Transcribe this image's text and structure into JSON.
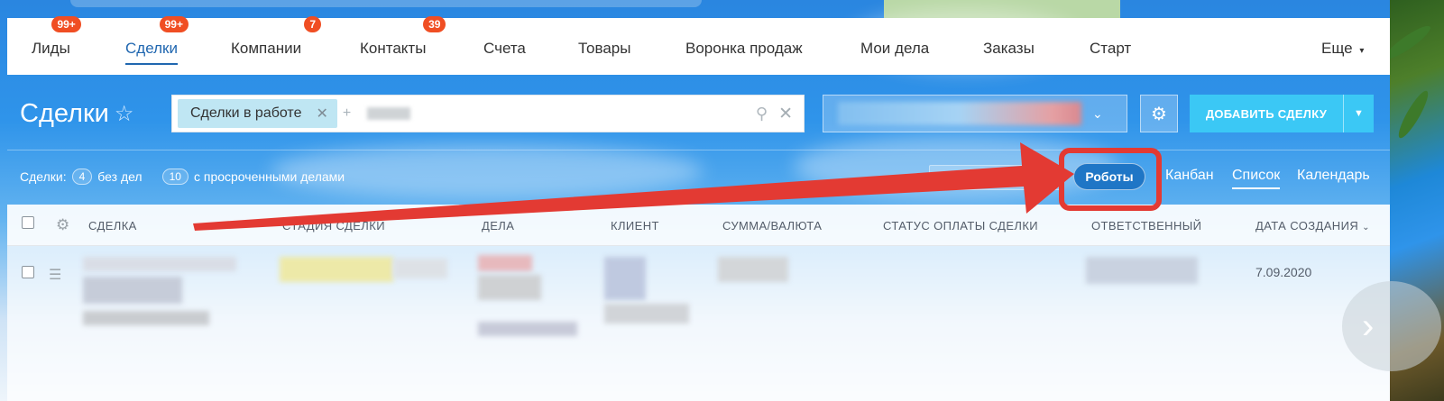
{
  "nav": {
    "items": [
      {
        "label": "Лиды",
        "badge": "99+"
      },
      {
        "label": "Сделки",
        "badge": "99+",
        "active": true
      },
      {
        "label": "Компании",
        "badge": "7"
      },
      {
        "label": "Контакты",
        "badge": "39"
      },
      {
        "label": "Счета"
      },
      {
        "label": "Товары"
      },
      {
        "label": "Воронка продаж"
      },
      {
        "label": "Мои дела"
      },
      {
        "label": "Заказы"
      },
      {
        "label": "Старт"
      }
    ],
    "more_label": "Еще",
    "more_icon": "chevron-down-icon"
  },
  "header": {
    "title": "Сделки",
    "favorite_icon": "star-icon"
  },
  "filter": {
    "chip_label": "Сделки в работе",
    "chip_close_icon": "close-icon",
    "add_icon": "plus-icon",
    "search_icon": "search-icon",
    "clear_icon": "close-icon"
  },
  "toolbar": {
    "settings_icon": "gear-icon",
    "add_button_label": "ДОБАВИТЬ СДЕЛКУ",
    "add_button_arrow_icon": "caret-down-icon"
  },
  "stats": {
    "deals_label": "Сделки:",
    "without_tasks_count": "4",
    "without_tasks_label": "без дел",
    "overdue_count": "10",
    "overdue_label": "с просроченными делами"
  },
  "views": {
    "robots_label": "Роботы",
    "kanban_label": "Канбан",
    "list_label": "Список",
    "calendar_label": "Календарь",
    "active": "Список"
  },
  "table": {
    "columns": [
      "СДЕЛКА",
      "СТАДИЯ СДЕЛКИ",
      "ДЕЛА",
      "КЛИЕНТ",
      "СУММА/ВАЛЮТА",
      "СТАТУС ОПЛАТЫ СДЕЛКИ",
      "ОТВЕТСТВЕННЫЙ",
      "ДАТА СОЗДАНИЯ"
    ],
    "sort_icon": "chevron-down-icon",
    "rows": [
      {
        "created_date": "7.09.2020"
      }
    ]
  },
  "annotation": {
    "color": "#e33a33",
    "highlighted_button": "Роботы"
  },
  "colors": {
    "accent": "#2067b0",
    "badge": "#f04e23",
    "add_button": "#3bc8f5"
  }
}
